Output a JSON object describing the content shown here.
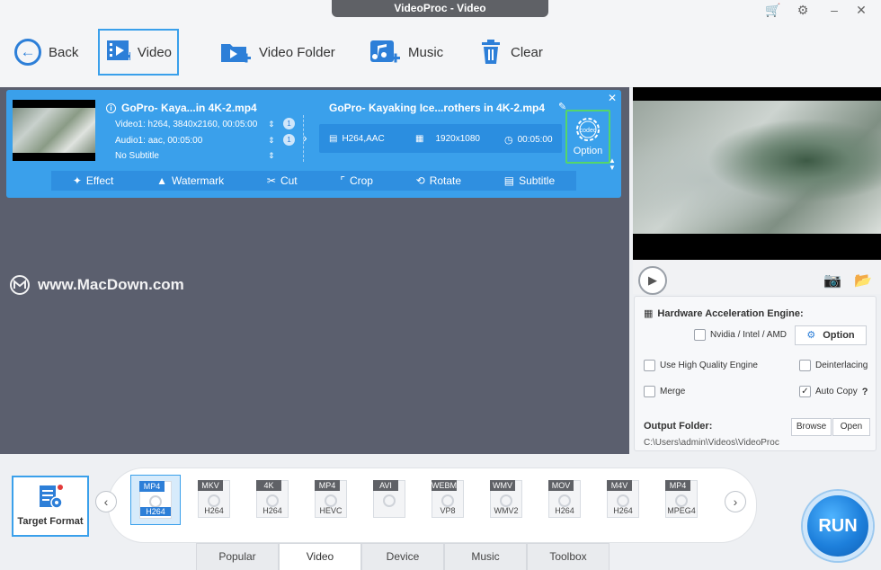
{
  "window": {
    "title": "VideoProc - Video"
  },
  "toolbar": {
    "back_label": "Back",
    "video_label": "Video",
    "video_folder_label": "Video Folder",
    "music_label": "Music",
    "clear_label": "Clear"
  },
  "item": {
    "source_name": "GoPro- Kaya...in 4K-2.mp4",
    "video_info": "Video1: h264, 3840x2160, 00:05:00",
    "audio_info": "Audio1: aac, 00:05:00",
    "subtitle_info": "No Subtitle",
    "track_badge_video": "1",
    "track_badge_audio": "1",
    "output_name": "GoPro- Kayaking Ice...rothers in 4K-2.mp4",
    "output_codec": "H264,AAC",
    "output_resolution": "1920x1080",
    "output_duration": "00:05:00",
    "codec_text": "codec",
    "option_label": "Option"
  },
  "edit_bar": {
    "effect": "Effect",
    "watermark": "Watermark",
    "cut": "Cut",
    "crop": "Crop",
    "rotate": "Rotate",
    "subtitle": "Subtitle"
  },
  "watermark_text": "www.MacDown.com",
  "settings": {
    "hw_title": "Hardware Acceleration Engine:",
    "hw_vendor": "Nvidia / Intel / AMD",
    "hw_option": "Option",
    "high_quality": "Use High Quality Engine",
    "deinterlacing": "Deinterlacing",
    "merge": "Merge",
    "auto_copy": "Auto Copy",
    "auto_copy_help": "?",
    "output_folder_label": "Output Folder:",
    "output_path": "C:\\Users\\admin\\Videos\\VideoProc",
    "browse": "Browse",
    "open": "Open"
  },
  "target_format": {
    "label": "Target Format"
  },
  "formats": [
    {
      "top": "MP4",
      "bottom": "H264",
      "selected": true
    },
    {
      "top": "MKV",
      "bottom": "H264"
    },
    {
      "top": "4K",
      "bottom": "H264"
    },
    {
      "top": "MP4",
      "bottom": "HEVC"
    },
    {
      "top": "AVI",
      "bottom": ""
    },
    {
      "top": "WEBM",
      "bottom": "VP8"
    },
    {
      "top": "WMV",
      "bottom": "WMV2"
    },
    {
      "top": "MOV",
      "bottom": "H264"
    },
    {
      "top": "M4V",
      "bottom": "H264"
    },
    {
      "top": "MP4",
      "bottom": "MPEG4"
    }
  ],
  "tabs": [
    "Popular",
    "Video",
    "Device",
    "Music",
    "Toolbox"
  ],
  "active_tab": "Video",
  "run_label": "RUN",
  "colors": {
    "accent": "#2d7fd8",
    "card": "#3aa0eb",
    "panel": "#5b5f6e",
    "highlight": "#54d66a"
  }
}
